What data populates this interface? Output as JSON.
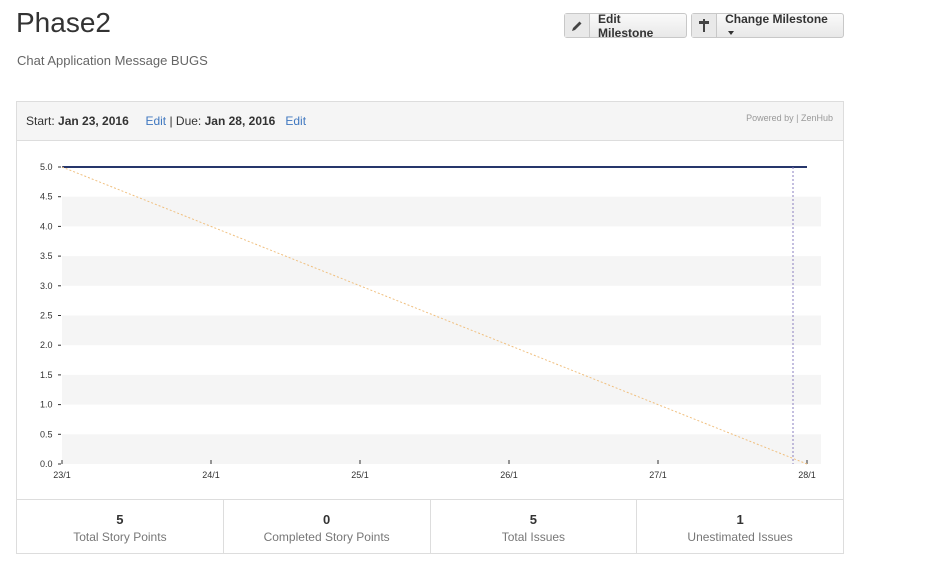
{
  "page": {
    "title": "Phase2",
    "subtitle": "Chat Application Message BUGS"
  },
  "toolbar": {
    "edit_label": "Edit Milestone",
    "change_label": "Change Milestone",
    "edit_icon": "pencil-icon",
    "change_icon": "signpost-icon"
  },
  "milestone": {
    "start_prefix": "Start:",
    "start_date": "Jan 23, 2016",
    "edit_start": "Edit",
    "due_prefix": "| Due:",
    "due_date": "Jan 28, 2016",
    "edit_due": "Edit",
    "powered_by": "Powered by",
    "brand": "ZenHub"
  },
  "stats": [
    {
      "value": "5",
      "label": "Total Story Points"
    },
    {
      "value": "0",
      "label": "Completed Story Points"
    },
    {
      "value": "5",
      "label": "Total Issues"
    },
    {
      "value": "1",
      "label": "Unestimated Issues"
    }
  ],
  "chart_data": {
    "type": "line",
    "title": "",
    "xlabel": "",
    "ylabel": "",
    "x": [
      "23/1",
      "24/1",
      "25/1",
      "26/1",
      "27/1",
      "28/1"
    ],
    "y_ticks": [
      "0.0",
      "0.5",
      "1.0",
      "1.5",
      "2.0",
      "2.5",
      "3.0",
      "3.5",
      "4.0",
      "4.5",
      "5.0"
    ],
    "ylim": [
      0,
      5
    ],
    "series": [
      {
        "x": [
          "23/1",
          "28/1"
        ],
        "values": [
          5,
          5
        ],
        "color": "#26366b"
      },
      {
        "x": [
          "23/1",
          "28/1"
        ],
        "values": [
          5,
          0
        ],
        "color": "#f0c080",
        "style": "dotted"
      }
    ],
    "marker_x": "28/1",
    "grid": "horizontal bands"
  }
}
